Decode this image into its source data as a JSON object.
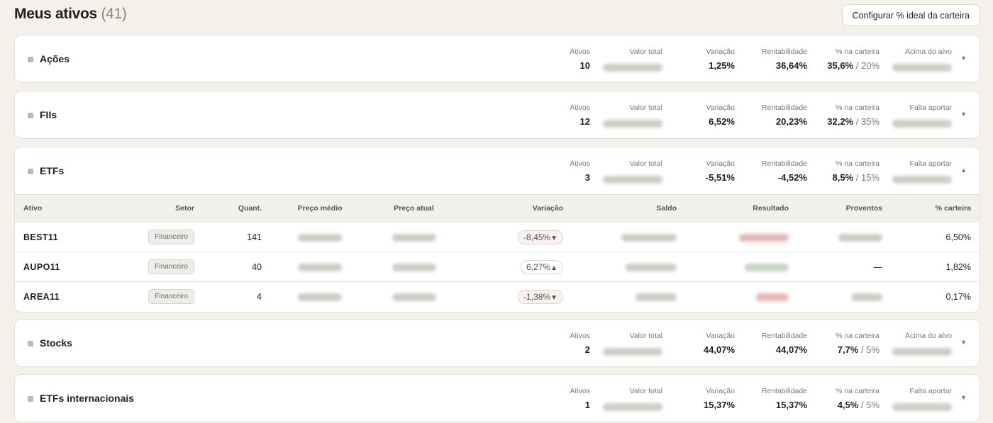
{
  "header": {
    "title": "Meus ativos",
    "count": "(41)",
    "config_button": "Configurar % ideal da carteira"
  },
  "labels": {
    "ativos": "Ativos",
    "valor_total": "Valor total",
    "variacao": "Variação",
    "rentabilidade": "Rentabilidade",
    "pct_carteira": "% na carteira"
  },
  "categories": [
    {
      "name": "Ações",
      "ativos": "10",
      "variacao": "1,25%",
      "rentabilidade": "36,64%",
      "pct": "35,6%",
      "target": "/ 20%",
      "alvo_label": "Acima do alvo",
      "chevron": "▼"
    },
    {
      "name": "FIIs",
      "ativos": "12",
      "variacao": "6,52%",
      "rentabilidade": "20,23%",
      "pct": "32,2%",
      "target": "/ 35%",
      "alvo_label": "Falta aportar",
      "chevron": "▼"
    },
    {
      "name": "ETFs",
      "ativos": "3",
      "variacao": "-5,51%",
      "rentabilidade": "-4,52%",
      "pct": "8,5%",
      "target": "/ 15%",
      "alvo_label": "Falta aportar",
      "chevron": "▲"
    },
    {
      "name": "Stocks",
      "ativos": "2",
      "variacao": "44,07%",
      "rentabilidade": "44,07%",
      "pct": "7,7%",
      "target": "/ 5%",
      "alvo_label": "Acima do alvo",
      "chevron": "▼"
    },
    {
      "name": "ETFs internacionais",
      "ativos": "1",
      "variacao": "15,37%",
      "rentabilidade": "15,37%",
      "pct": "4,5%",
      "target": "/ 5%",
      "alvo_label": "Falta aportar",
      "chevron": "▼"
    }
  ],
  "table": {
    "columns": [
      "Ativo",
      "Setor",
      "Quant.",
      "Preço médio",
      "Preço atual",
      "Variação",
      "Saldo",
      "Resultado",
      "Proventos",
      "% carteira"
    ],
    "rows": [
      {
        "ticker": "BEST11",
        "sector": "Financeiro",
        "qty": "141",
        "variation": "-8,45%",
        "arrow": "▼",
        "trend": "down",
        "proventos": "",
        "pct": "6,50%"
      },
      {
        "ticker": "AUPO11",
        "sector": "Financeiro",
        "qty": "40",
        "variation": "6,27%",
        "arrow": "▲",
        "trend": "up",
        "proventos": "—",
        "pct": "1,82%"
      },
      {
        "ticker": "AREA11",
        "sector": "Financeiro",
        "qty": "4",
        "variation": "-1,38%",
        "arrow": "▼",
        "trend": "down",
        "proventos": "",
        "pct": "0,17%"
      }
    ]
  },
  "colors": {
    "background": "#f4f1ea",
    "card": "#ffffff",
    "table_header": "#f2f0eb",
    "negative_blur": "#e8b7b0",
    "positive_blur": "#c3d6c4"
  }
}
